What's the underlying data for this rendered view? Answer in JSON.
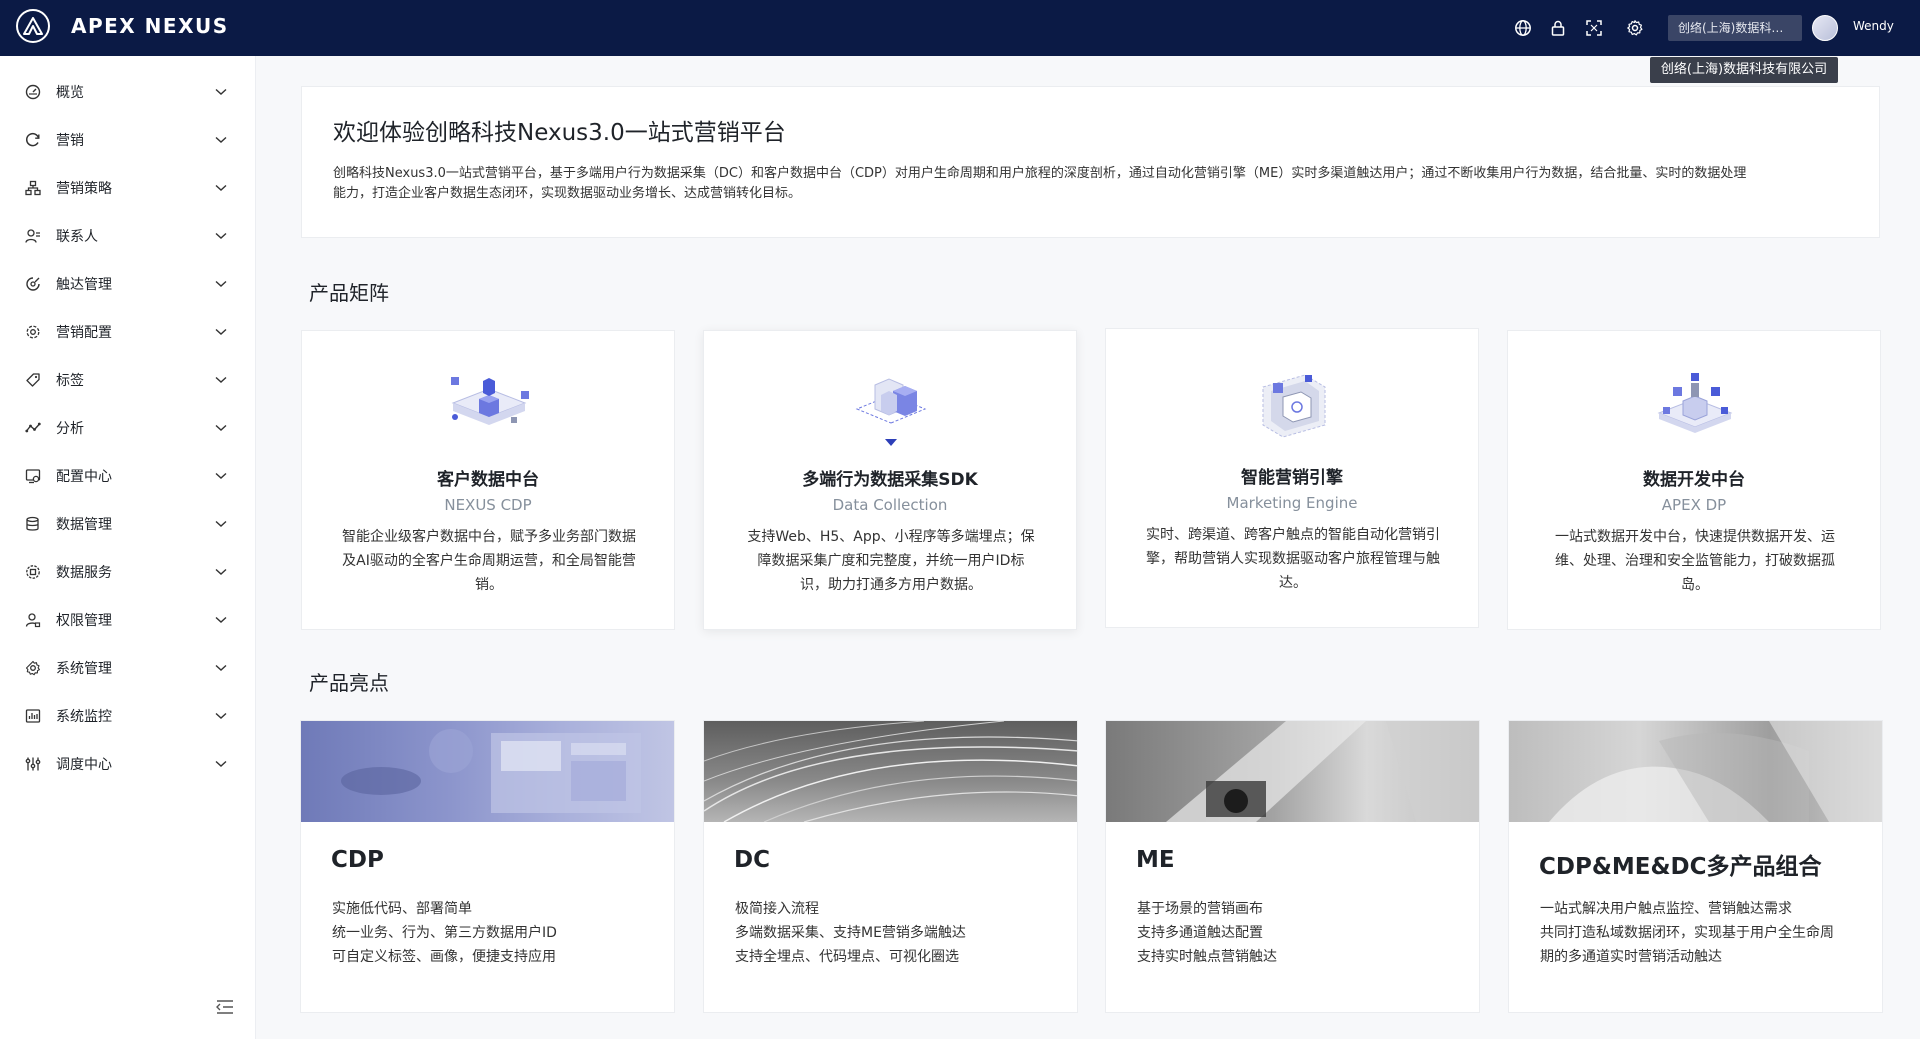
{
  "header": {
    "brand": "APEX NEXUS",
    "tenant_short": "创络(上海)数据科技有限公司",
    "tenant_tooltip": "创络(上海)数据科技有限公司",
    "username": "Wendy",
    "icons": [
      "globe-icon",
      "lock-icon",
      "fullscreen-icon",
      "settings-icon"
    ]
  },
  "sidebar": {
    "items": [
      {
        "label": "概览",
        "icon": "dashboard-icon"
      },
      {
        "label": "营销",
        "icon": "refresh-icon"
      },
      {
        "label": "营销策略",
        "icon": "strategy-icon"
      },
      {
        "label": "联系人",
        "icon": "contacts-icon"
      },
      {
        "label": "触达管理",
        "icon": "reach-icon"
      },
      {
        "label": "营销配置",
        "icon": "config-icon"
      },
      {
        "label": "标签",
        "icon": "tag-icon"
      },
      {
        "label": "分析",
        "icon": "analytics-icon"
      },
      {
        "label": "配置中心",
        "icon": "config-center-icon"
      },
      {
        "label": "数据管理",
        "icon": "database-icon"
      },
      {
        "label": "数据服务",
        "icon": "data-service-icon"
      },
      {
        "label": "权限管理",
        "icon": "permission-icon"
      },
      {
        "label": "系统管理",
        "icon": "system-icon"
      },
      {
        "label": "系统监控",
        "icon": "monitor-icon"
      },
      {
        "label": "调度中心",
        "icon": "schedule-icon"
      }
    ]
  },
  "welcome": {
    "title": "欢迎体验创略科技Nexus3.0一站式营销平台",
    "desc_line1": "创略科技Nexus3.0一站式营销平台，基于多端用户行为数据采集（DC）和客户数据中台（CDP）对用户生命周期和用户旅程的深度剖析，通过自动化营销引擎（ME）实时多渠道触达用户；通过不断收集用户行为数据，结合批量、实时的数据处理",
    "desc_line2": "能力，打造企业客户数据生态闭环，实现数据驱动业务增长、达成营销转化目标。"
  },
  "sections": {
    "matrix_title": "产品矩阵",
    "highlights_title": "产品亮点"
  },
  "products": [
    {
      "name": "客户数据中台",
      "sub": "NEXUS CDP",
      "desc": "智能企业级客户数据中台，赋予多业务部门数据及AI驱动的全客户生命周期运营，和全局智能营销。"
    },
    {
      "name": "多端行为数据采集SDK",
      "sub": "Data Collection",
      "desc": "支持Web、H5、App、小程序等多端埋点；保障数据采集广度和完整度，并统一用户ID标识，助力打通多方用户数据。"
    },
    {
      "name": "智能营销引擎",
      "sub": "Marketing Engine",
      "desc": "实时、跨渠道、跨客户触点的智能自动化营销引擎，帮助营销人实现数据驱动客户旅程管理与触达。"
    },
    {
      "name": "数据开发中台",
      "sub": "APEX DP",
      "desc": "一站式数据开发中台，快速提供数据开发、运维、处理、治理和安全监管能力，打破数据孤岛。"
    }
  ],
  "highlights": [
    {
      "title": "CDP",
      "lines": [
        "实施低代码、部署简单",
        "统一业务、行为、第三方数据用户ID",
        "可自定义标签、画像，便捷支持应用"
      ]
    },
    {
      "title": "DC",
      "lines": [
        "极简接入流程",
        "多端数据采集、支持ME营销多端触达",
        "支持全埋点、代码埋点、可视化圈选"
      ]
    },
    {
      "title": "ME",
      "lines": [
        "基于场景的营销画布",
        "支持多通道触达配置",
        "支持实时触点营销触达"
      ]
    },
    {
      "title": "CDP&ME&DC多产品组合",
      "lines": [
        "一站式解决用户触点监控、营销触达需求",
        "共同打造私域数据闭环，实现基于用户全生命周",
        "期的多通道实时营销活动触达"
      ]
    }
  ],
  "colors": {
    "topbar": "#0b1a45",
    "accent": "#4a5bd8",
    "cdp_image_tint": "#7c86c2"
  }
}
